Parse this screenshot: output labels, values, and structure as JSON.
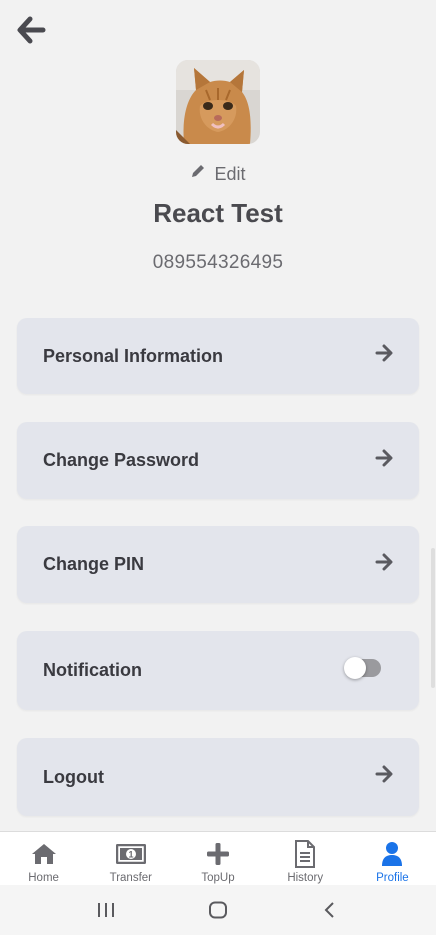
{
  "profile": {
    "edit_label": "Edit",
    "name": "React Test",
    "phone": "089554326495"
  },
  "menu": {
    "personal_information": "Personal Information",
    "change_password": "Change Password",
    "change_pin": "Change PIN",
    "notification": "Notification",
    "notification_enabled": false,
    "logout": "Logout"
  },
  "tabbar": {
    "home": "Home",
    "transfer": "Transfer",
    "topup": "TopUp",
    "history": "History",
    "profile": "Profile",
    "active_tab": "Profile"
  },
  "icons": {
    "back": "arrow-left-icon",
    "edit": "pencil-icon",
    "menu_arrow": "arrow-right-icon",
    "home": "home-icon",
    "transfer": "money-bill-icon",
    "topup": "plus-icon",
    "history": "document-icon",
    "profile": "user-icon"
  },
  "colors": {
    "background": "#f2f2f2",
    "card": "#e3e5ec",
    "active_tab": "#1a73e8",
    "text_dark": "#3a3a40",
    "text_muted": "#6b6b70"
  }
}
